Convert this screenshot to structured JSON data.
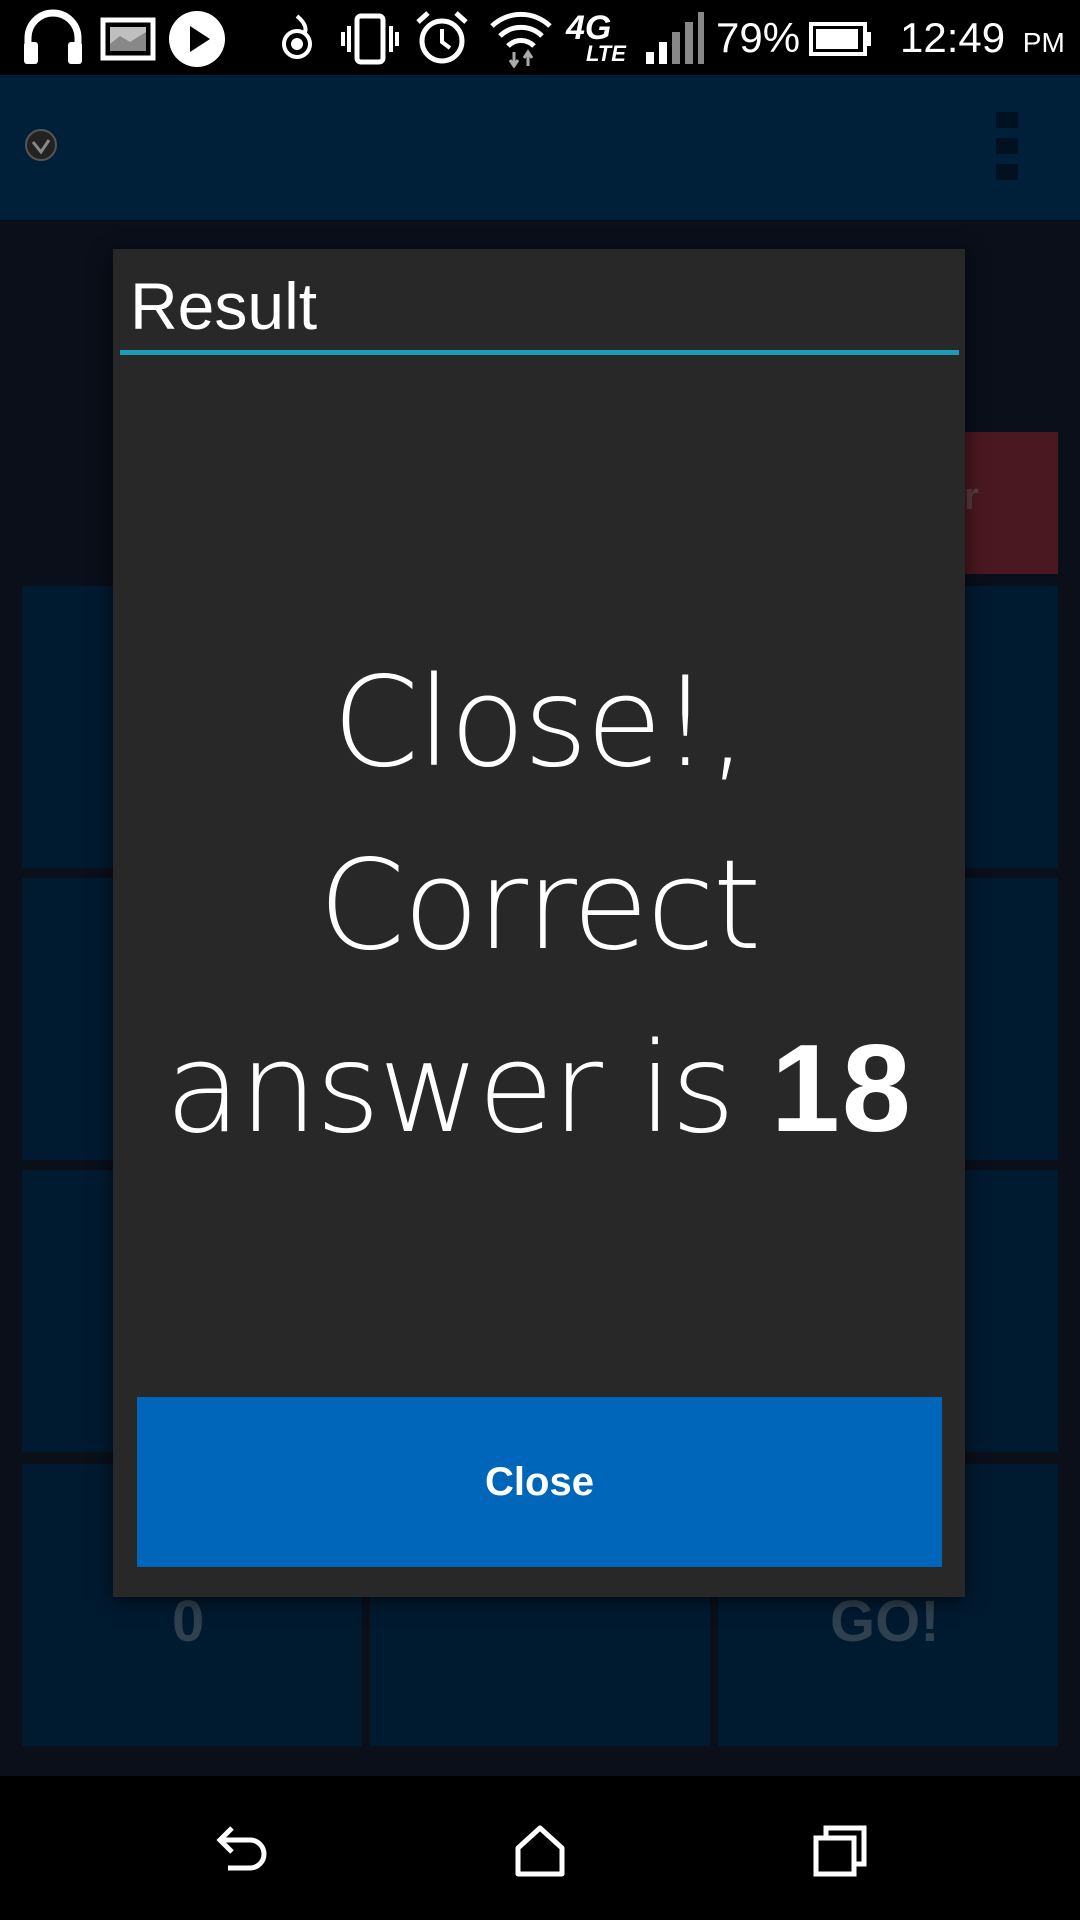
{
  "status_bar": {
    "battery_percent": "79%",
    "time": "12:49",
    "ampm": "PM",
    "network_label_top": "4G",
    "network_label_bottom": "LTE",
    "icons": [
      "headphones-icon",
      "gallery-icon",
      "play-icon",
      "hotspot-icon",
      "vibrate-icon",
      "alarm-icon",
      "wifi-icon",
      "lte-icon",
      "signal-icon",
      "battery-icon"
    ]
  },
  "app_bar": {
    "icons": [
      "app-logo-icon",
      "overflow-menu-icon"
    ]
  },
  "background": {
    "keys": [
      {
        "label": ""
      },
      {
        "label": ""
      },
      {
        "label": ""
      },
      {
        "label": ""
      },
      {
        "label": ""
      },
      {
        "label": ""
      },
      {
        "label": ""
      },
      {
        "label": ""
      },
      {
        "label": ""
      },
      {
        "label": "0"
      },
      {
        "label": ""
      },
      {
        "label": "GO!"
      }
    ],
    "clear_label_visible": "r"
  },
  "dialog": {
    "title": "Result",
    "message_part1": "Close!,",
    "message_part2": "Correct",
    "message_part3": "answer is ",
    "answer_value": "18",
    "close_button_label": "Close"
  },
  "colors": {
    "app_bar": "#001f38",
    "dialog_bg": "#282828",
    "divider": "#1d9db5",
    "close_button": "#0066ba",
    "key_bg": "#001a30",
    "clear_key": "#4a1820"
  },
  "nav_bar": {
    "buttons": [
      "back-icon",
      "home-icon",
      "recents-icon"
    ]
  }
}
